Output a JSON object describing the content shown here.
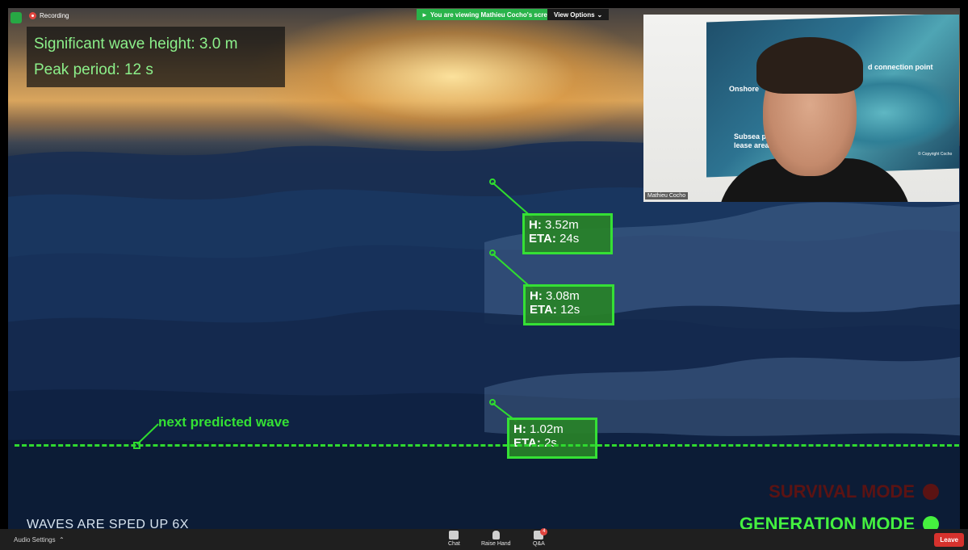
{
  "recording": {
    "label": "Recording"
  },
  "share_banner": {
    "text": "You are viewing Mathieu Cocho's screen",
    "view_options": "View Options"
  },
  "info_panel": {
    "wave_height": "Significant wave height: 3.0 m",
    "peak_period": "Peak period: 12 s"
  },
  "camera": {
    "name": "Mathieu Cocho",
    "poster_labels": [
      "d connection point",
      "Onshore",
      "Subsea pipe",
      "lease area",
      "© Copyright Cocho"
    ]
  },
  "waves": [
    {
      "height_label": "H:",
      "height_value": "3.52m",
      "eta_label": "ETA:",
      "eta_value": "24s"
    },
    {
      "height_label": "H:",
      "height_value": "3.08m",
      "eta_label": "ETA:",
      "eta_value": "12s"
    },
    {
      "height_label": "H:",
      "height_value": "1.02m",
      "eta_label": "ETA:",
      "eta_value": "2s"
    }
  ],
  "next_wave_label": "next predicted wave",
  "speed_note": "WAVES ARE SPED UP 6X",
  "modes": {
    "survival": {
      "label": "SURVIVAL MODE",
      "color": "#5b1313"
    },
    "generation": {
      "label": "GENERATION MODE",
      "color": "#45f03f"
    }
  },
  "toolbar": {
    "audio_settings": "Audio Settings",
    "chat": "Chat",
    "raise_hand": "Raise Hand",
    "qa": "Q&A",
    "qa_badge": "4",
    "leave": "Leave"
  },
  "colors": {
    "accent_green": "#2fdc2f",
    "leave_red": "#d6322d",
    "share_green": "#29b34a"
  }
}
